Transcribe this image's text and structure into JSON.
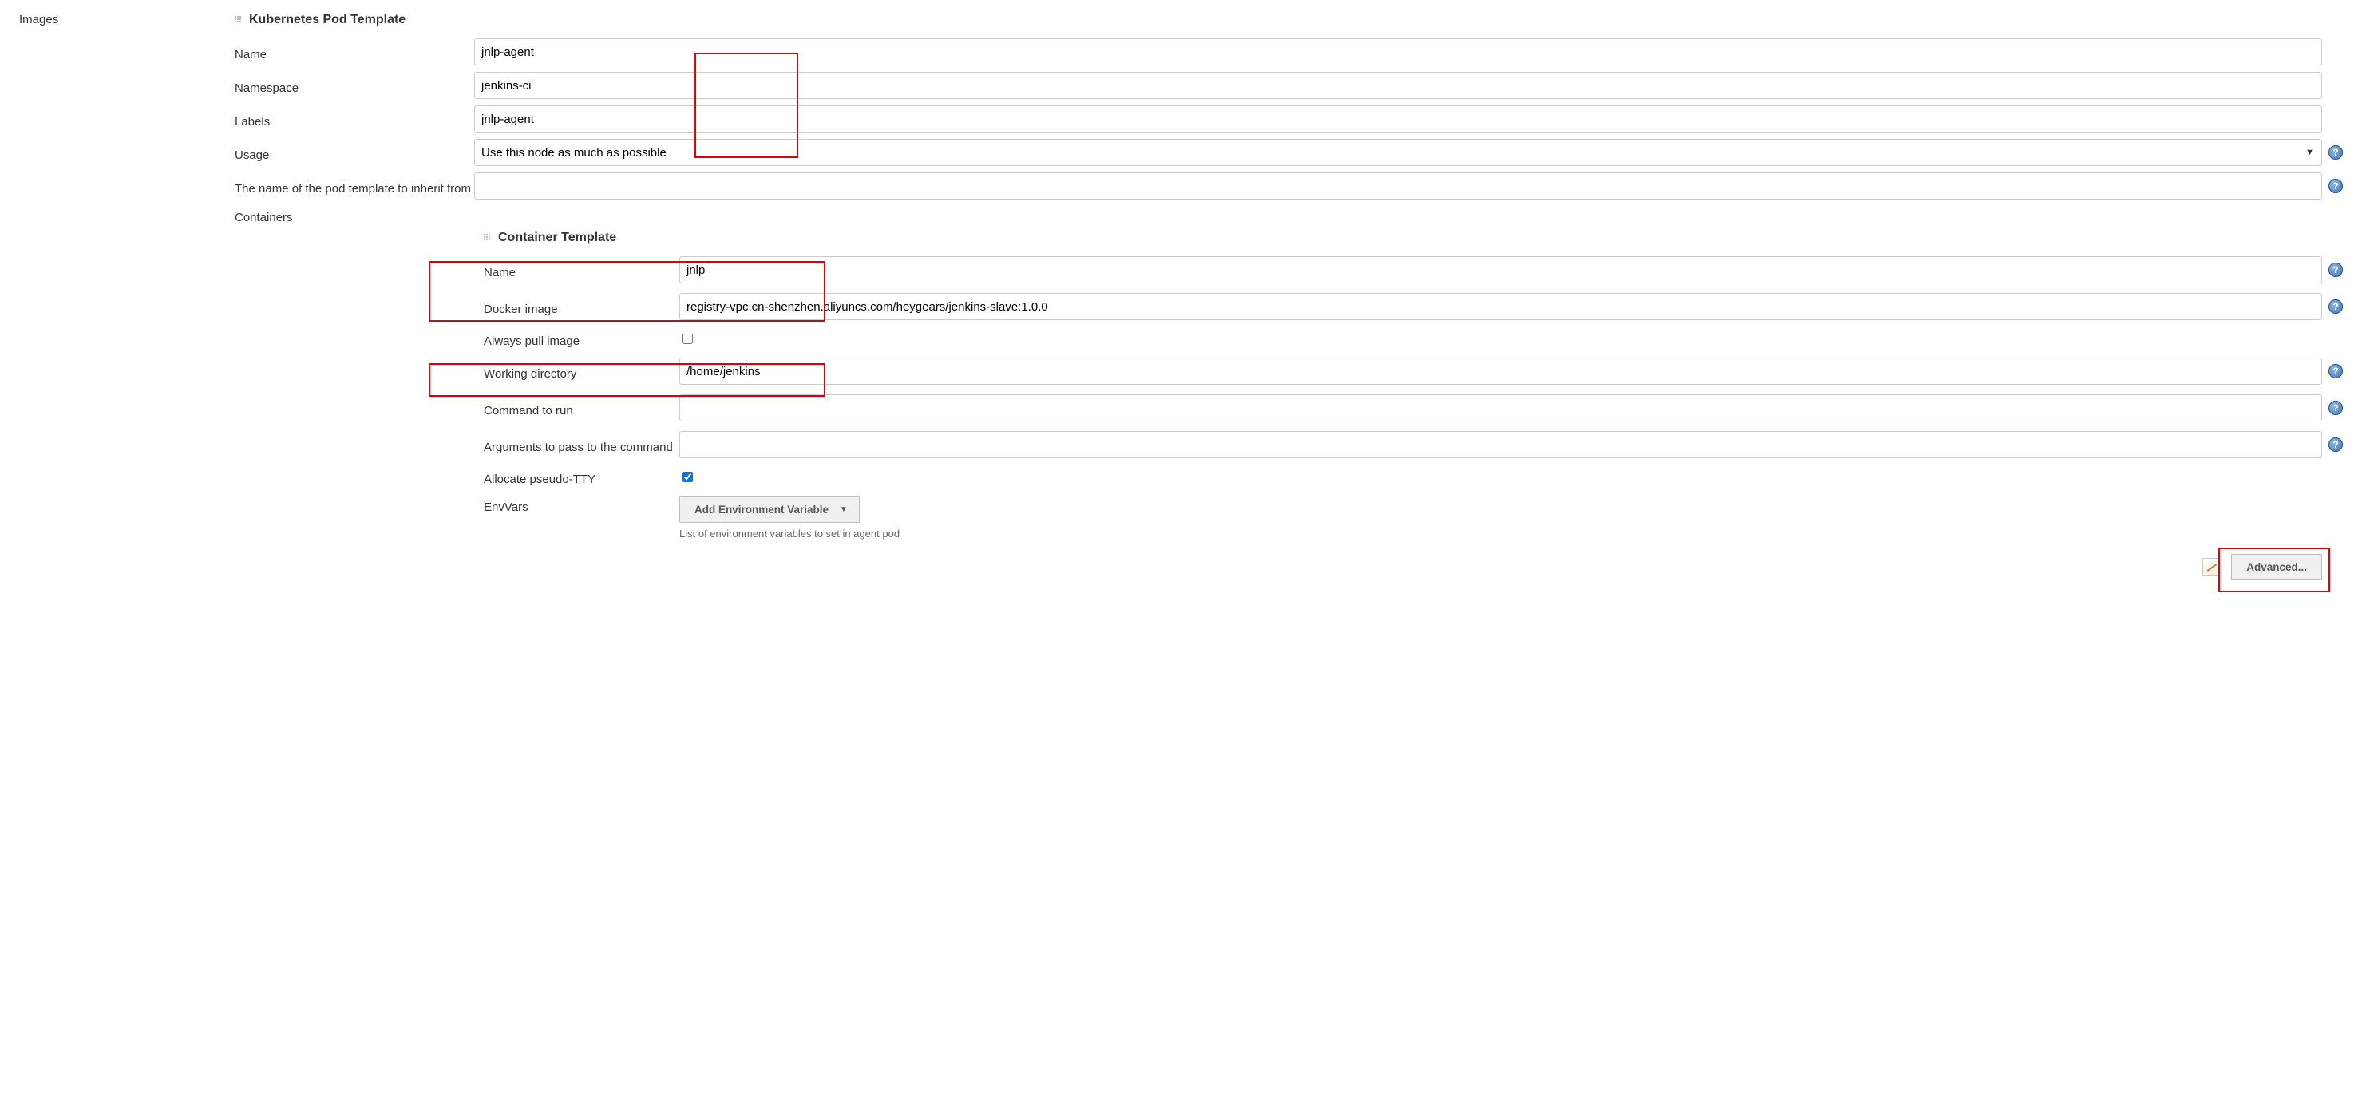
{
  "outer_label": "Images",
  "pod": {
    "header": "Kubernetes Pod Template",
    "name_label": "Name",
    "name_value": "jnlp-agent",
    "namespace_label": "Namespace",
    "namespace_value": "jenkins-ci",
    "labels_label": "Labels",
    "labels_value": "jnlp-agent",
    "usage_label": "Usage",
    "usage_value": "Use this node as much as possible",
    "inherit_label": "The name of the pod template to inherit from",
    "inherit_value": "",
    "containers_label": "Containers"
  },
  "container": {
    "header": "Container Template",
    "name_label": "Name",
    "name_value": "jnlp",
    "docker_label": "Docker image",
    "docker_value": "registry-vpc.cn-shenzhen.aliyuncs.com/heygears/jenkins-slave:1.0.0",
    "pull_label": "Always pull image",
    "wd_label": "Working directory",
    "wd_value": "/home/jenkins",
    "cmd_label": "Command to run",
    "cmd_value": "",
    "args_label": "Arguments to pass to the command",
    "args_value": "",
    "tty_label": "Allocate pseudo-TTY",
    "envvars_label": "EnvVars",
    "envvars_button": "Add Environment Variable",
    "envvars_desc": "List of environment variables to set in agent pod",
    "advanced_button": "Advanced..."
  }
}
